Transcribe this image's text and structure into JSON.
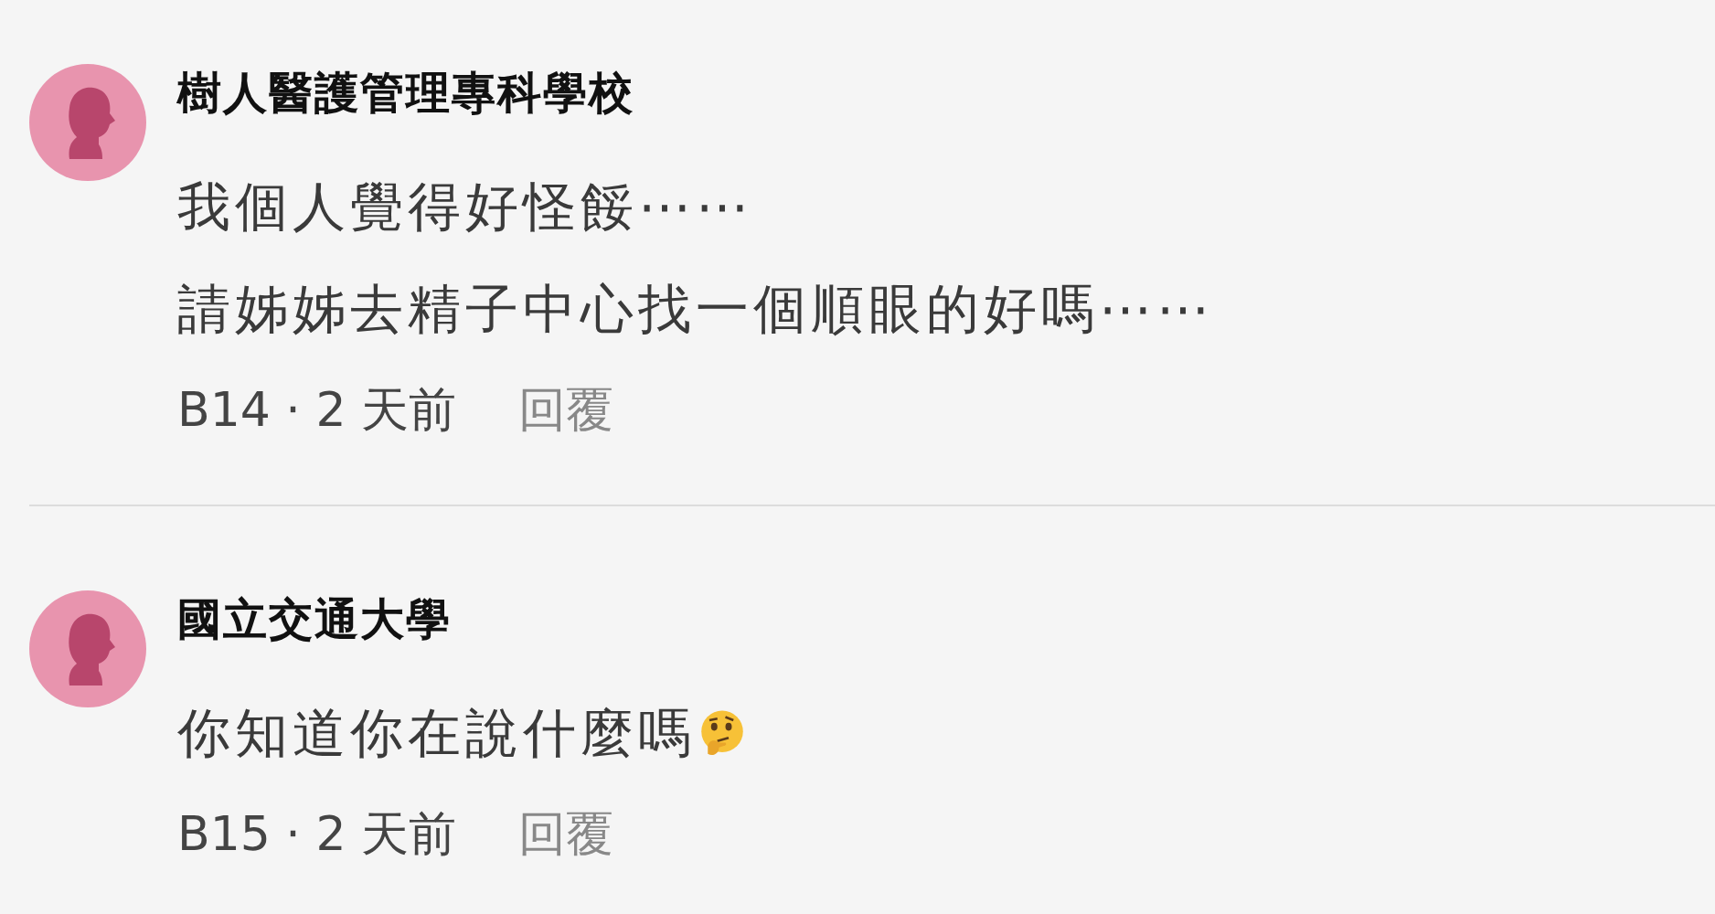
{
  "comments": [
    {
      "author": "樹人醫護管理專科學校",
      "lines": [
        "我個人覺得好怪餒⋯⋯",
        "請姊姊去精子中心找一個順眼的好嗎⋯⋯"
      ],
      "emoji": false,
      "meta": "B14 · 2 天前",
      "reply": "回覆"
    },
    {
      "author": "國立交通大學",
      "lines": [
        "你知道你在說什麼嗎"
      ],
      "emoji": true,
      "meta": "B15 · 2 天前",
      "reply": "回覆"
    }
  ]
}
